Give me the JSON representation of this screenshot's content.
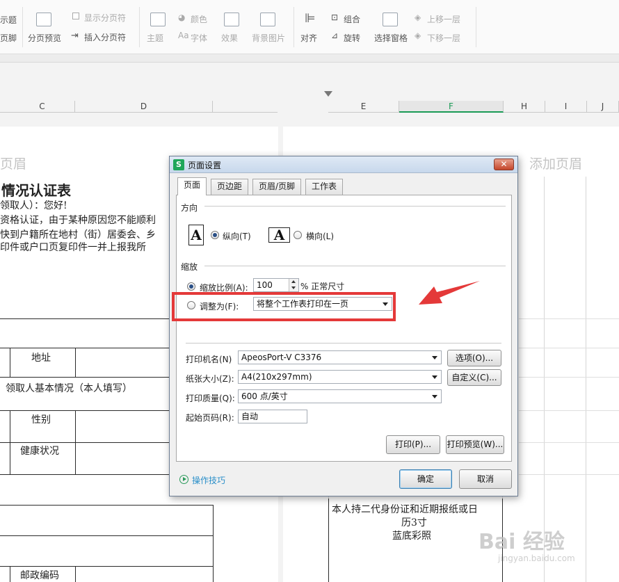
{
  "ribbon": {
    "frag_top": "示题",
    "frag_bottom": "页脚",
    "page_preview": "分页预览",
    "show_page_break": "显示分页符",
    "insert_page_break": "插入分页符",
    "theme": "主题",
    "colors": "颜色",
    "fonts": "字体",
    "effects": "效果",
    "background": "背景图片",
    "align": "对齐",
    "group": "组合",
    "rotate": "旋转",
    "selection_pane": "选择窗格",
    "bring_forward": "上移一层",
    "send_backward": "下移一层"
  },
  "sheet": {
    "columns": [
      "C",
      "D",
      "E",
      "F",
      "H",
      "I",
      "J"
    ],
    "header_left": "页眉",
    "header_right": "添加页眉",
    "doc_title": "情况认证表",
    "line1": "领取人）：您好!",
    "line2": "资格认证，由于某种原因您不能顺利",
    "line3": "快到户籍所在地村（街）居委会、乡",
    "line4": "印件或户口页复印件一并上报我所",
    "cell_address": "地址",
    "cell_section": "领取人基本情况（本人填写）",
    "cell_gender": "性别",
    "cell_health": "健康状况",
    "cell_postcode": "邮政编码",
    "photo_note_1": "本人持二代身份证和近期报纸或日",
    "photo_note_2": "历3寸",
    "photo_note_3": "蓝底彩照"
  },
  "dialog": {
    "title": "页面设置",
    "tabs": [
      "页面",
      "页边距",
      "页眉/页脚",
      "工作表"
    ],
    "orientation_group": "方向",
    "portrait": "纵向(T)",
    "landscape": "横向(L)",
    "orientation_icon_letter": "A",
    "scaling_group": "缩放",
    "scale_ratio": "缩放比例(A):",
    "scale_value": "100",
    "scale_unit": "% 正常尺寸",
    "fit_to": "调整为(F):",
    "fit_option": "将整个工作表打印在一页",
    "printer_label": "打印机名(N)",
    "printer_value": "ApeosPort-V C3376",
    "options_button": "选项(O)...",
    "paper_label": "纸张大小(Z):",
    "paper_value": "A4(210x297mm)",
    "custom_button": "自定义(C)...",
    "quality_label": "打印质量(Q):",
    "quality_value": "600 点/英寸",
    "start_page_label": "起始页码(R):",
    "start_page_value": "自动",
    "print_button": "打印(P)...",
    "preview_button": "打印预览(W)...",
    "tips_link": "操作技巧",
    "ok_button": "确定",
    "cancel_button": "取消",
    "app_badge": "S",
    "close_glyph": "✕"
  },
  "watermark": {
    "line1": "Bai 经验",
    "line2": "jingyan.baidu.com"
  },
  "colors": {
    "annotation_red": "#e43939",
    "accent_green": "#1a9a55"
  }
}
